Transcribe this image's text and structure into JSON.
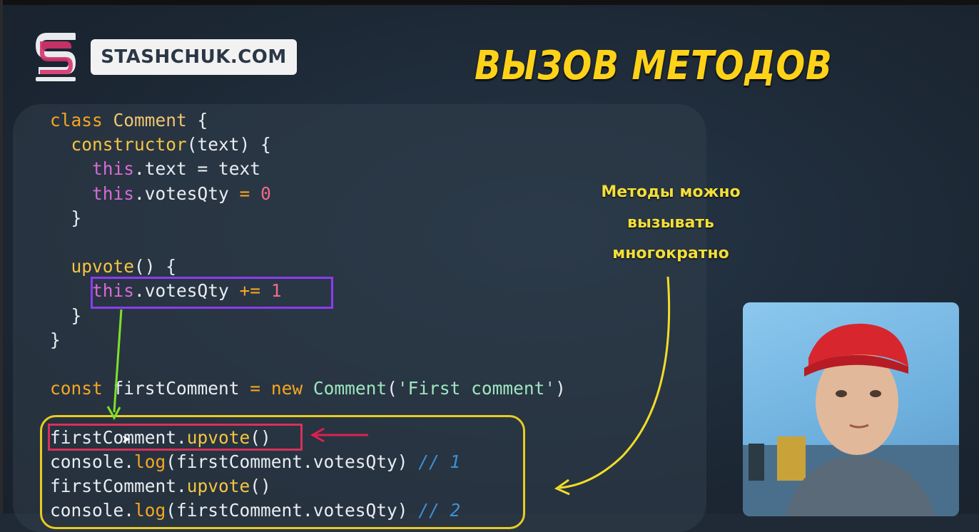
{
  "logo": {
    "text": "STASHCHUK.COM"
  },
  "title": "ВЫЗОВ МЕТОДОВ",
  "note": {
    "lines": [
      "Методы можно",
      "вызывать",
      "многократно"
    ]
  },
  "code": {
    "kw_class": "class",
    "class_name": "Comment",
    "brace_open": " {",
    "kw_constructor": "constructor",
    "constructor_params": "(text) {",
    "this1": "this",
    "assign1": ".text = text",
    "this2": "this",
    "assign2": ".votesQty ",
    "eq": "=",
    "zero": "0",
    "close_inner": "}",
    "method_name": "upvote",
    "method_sig": "() {",
    "this3": "this",
    "incr_target": ".votesQty ",
    "incr_op": "+=",
    "one": "1",
    "close_method": "}",
    "close_class": "}",
    "kw_const": "const",
    "var_name": " firstComment ",
    "eq2": "=",
    "kw_new": "new",
    "ctor_call": "Comment",
    "str_open": "(",
    "str_literal": "'First comment'",
    "str_close": ")",
    "line_upvote1_obj": "firstComment.",
    "line_upvote1_call": "upvote",
    "line_upvote1_paren": "()",
    "line_log1_obj": "console.",
    "line_log1_fn": "log",
    "line_log1_args": "(firstComment.votesQty) ",
    "line_log1_comment": "// 1",
    "line_upvote2_obj": "firstComment.",
    "line_upvote2_call": "upvote",
    "line_upvote2_paren": "()",
    "line_log2_obj": "console.",
    "line_log2_fn": "log",
    "line_log2_args": "(firstComment.votesQty) ",
    "line_log2_comment": "// 2"
  },
  "colors": {
    "accent": "#ffd21a",
    "purple_box": "#8b3cf0",
    "red_box": "#d8305a",
    "yellow_box": "#e8cc22"
  },
  "icons": [
    "stashchuk-logo-icon",
    "cursor-icon"
  ]
}
